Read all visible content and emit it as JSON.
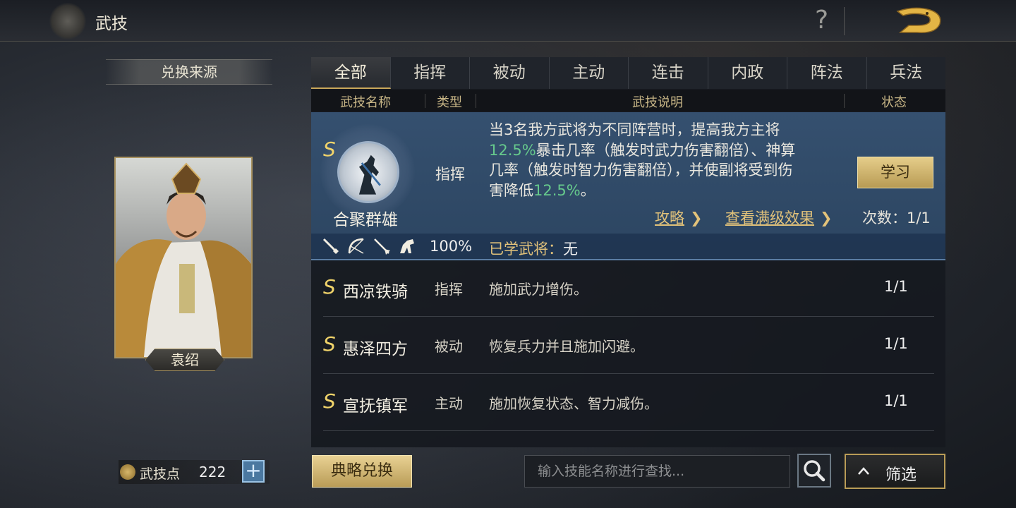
{
  "header": {
    "title": "武技",
    "help_icon": "?"
  },
  "left": {
    "source_title": "兑换来源",
    "hero_name": "袁绍",
    "points_label": "武技点",
    "points_value": "222",
    "points_add": "+"
  },
  "tabs": [
    {
      "label": "全部",
      "active": true
    },
    {
      "label": "指挥"
    },
    {
      "label": "被动"
    },
    {
      "label": "主动"
    },
    {
      "label": "连击"
    },
    {
      "label": "内政"
    },
    {
      "label": "阵法"
    },
    {
      "label": "兵法"
    }
  ],
  "columns": {
    "name": "武技名称",
    "type": "类型",
    "desc": "武技说明",
    "state": "状态"
  },
  "selected": {
    "grade": "S",
    "name": "合聚群雄",
    "type": "指挥",
    "desc_1": "当3名我方武将为不同阵营时，提高我方主将",
    "desc_pct_1": "12.5%",
    "desc_2": "暴击几率（触发时武力伤害翻倍）、神算",
    "desc_3": "几率（触发时智力伤害翻倍），并使副将受到伤",
    "desc_4": "害降低",
    "desc_pct_2": "12.5%",
    "desc_end": "。",
    "learn_label": "学习",
    "guide_link": "攻略",
    "full_effect_link": "查看满级效果",
    "count": "次数：1/1",
    "percent": "100%",
    "learned_label": "已学武将：",
    "learned_value": "无",
    "weapon_icons": [
      "sword-icon",
      "bow-icon",
      "spear-icon",
      "horse-icon"
    ]
  },
  "rows": [
    {
      "grade": "S",
      "name": "西凉铁骑",
      "type": "指挥",
      "desc": "施加武力增伤。",
      "state": "1/1"
    },
    {
      "grade": "S",
      "name": "惠泽四方",
      "type": "被动",
      "desc": "恢复兵力并且施加闪避。",
      "state": "1/1"
    },
    {
      "grade": "S",
      "name": "宣抚镇军",
      "type": "主动",
      "desc": "施加恢复状态、智力减伤。",
      "state": "1/1"
    }
  ],
  "bottom": {
    "exchange_label": "典略兑换",
    "search_placeholder": "输入技能名称进行查找...",
    "filter_label": "筛选"
  },
  "colors": {
    "accent_gold": "#c9a85a",
    "highlight_green": "#66c98c",
    "selected_blue": "#35506f"
  }
}
